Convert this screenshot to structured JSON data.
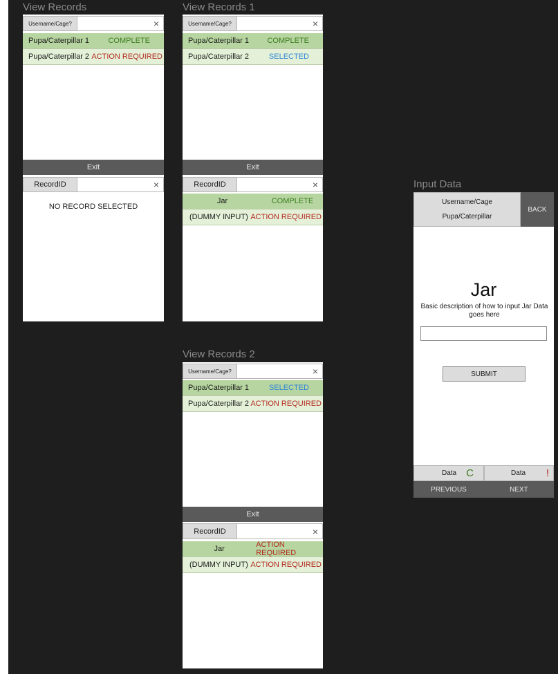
{
  "frames": {
    "view_records": {
      "title": "View Records",
      "search_placeholder": "Username/Cage?",
      "close": "×",
      "records": [
        {
          "name": "Pupa/Caterpillar 1",
          "status": "COMPLETE"
        },
        {
          "name": "Pupa/Caterpillar 2",
          "status": "ACTION REQUIRED"
        }
      ],
      "exit_label": "Exit",
      "record_search_label": "RecordID",
      "empty_message": "NO RECORD SELECTED"
    },
    "view_records_1": {
      "title": "View Records 1",
      "search_placeholder": "Username/Cage?",
      "close": "×",
      "records": [
        {
          "name": "Pupa/Caterpillar 1",
          "status": "COMPLETE"
        },
        {
          "name": "Pupa/Caterpillar 2",
          "status": "SELECTED"
        }
      ],
      "exit_label": "Exit",
      "record_search_label": "RecordID",
      "details": [
        {
          "name": "Jar",
          "status": "COMPLETE"
        },
        {
          "name": "(DUMMY INPUT)",
          "status": "ACTION REQUIRED"
        }
      ]
    },
    "view_records_2": {
      "title": "View Records 2",
      "search_placeholder": "Username/Cage?",
      "close": "×",
      "records": [
        {
          "name": "Pupa/Caterpillar 1",
          "status": "SELECTED"
        },
        {
          "name": "Pupa/Caterpillar 2",
          "status": "ACTION REQUIRED"
        }
      ],
      "exit_label": "Exit",
      "record_search_label": "RecordID",
      "details": [
        {
          "name": "Jar",
          "status": "ACTION REQUIRED"
        },
        {
          "name": "(DUMMY INPUT)",
          "status": "ACTION REQUIRED"
        }
      ]
    },
    "input_data": {
      "title": "Input Data",
      "header_line1": "Username/Cage",
      "header_line2": "Pupa/Caterpillar",
      "back_label": "BACK",
      "heading": "Jar",
      "description": "Basic description of how to input Jar Data goes here",
      "input_value": "",
      "submit_label": "SUBMIT",
      "tabs": [
        {
          "label": "Data",
          "indicator": "C"
        },
        {
          "label": "Data",
          "indicator": "!"
        }
      ],
      "previous_label": "PREVIOUS",
      "next_label": "NEXT"
    }
  },
  "colors": {
    "canvas": "#1e1e1e",
    "row_dark": "#b7d5a0",
    "row_light": "#e4f1d8",
    "complete": "#3a7d1e",
    "action_required": "#b3261e",
    "selected": "#2f86d6",
    "exit_bar": "#5a5a5a"
  }
}
